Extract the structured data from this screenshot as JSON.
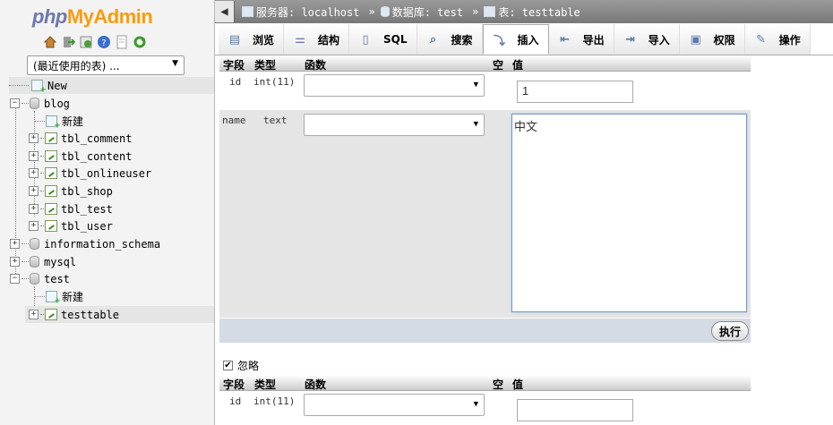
{
  "logo": {
    "part1": "php",
    "part2": "MyAdmin"
  },
  "nav": {
    "icons": [
      "home-icon",
      "logout-icon",
      "query-window-icon",
      "help-icon",
      "docs-icon",
      "reload-icon"
    ],
    "recent_select": "(最近使用的表) ...",
    "tree": [
      {
        "label": "New",
        "type": "new"
      },
      {
        "label": "blog",
        "type": "db"
      },
      {
        "label": "新建",
        "type": "new"
      },
      {
        "label": "tbl_comment",
        "type": "table"
      },
      {
        "label": "tbl_content",
        "type": "table"
      },
      {
        "label": "tbl_onlineuser",
        "type": "table"
      },
      {
        "label": "tbl_shop",
        "type": "table"
      },
      {
        "label": "tbl_test",
        "type": "table"
      },
      {
        "label": "tbl_user",
        "type": "table"
      },
      {
        "label": "information_schema",
        "type": "db"
      },
      {
        "label": "mysql",
        "type": "db"
      },
      {
        "label": "test",
        "type": "db"
      },
      {
        "label": "新建",
        "type": "new"
      },
      {
        "label": "testtable",
        "type": "table"
      }
    ]
  },
  "breadcrumb": {
    "server": "服务器: localhost",
    "database": "数据库: test",
    "table": "表: testtable"
  },
  "tabs": [
    {
      "label": "浏览",
      "icon": "browse-icon"
    },
    {
      "label": "结构",
      "icon": "structure-icon"
    },
    {
      "label": "SQL",
      "icon": "sql-icon"
    },
    {
      "label": "搜索",
      "icon": "search-icon"
    },
    {
      "label": "插入",
      "icon": "insert-icon"
    },
    {
      "label": "导出",
      "icon": "export-icon"
    },
    {
      "label": "导入",
      "icon": "import-icon"
    },
    {
      "label": "权限",
      "icon": "privileges-icon"
    },
    {
      "label": "操作",
      "icon": "operations-icon"
    }
  ],
  "form": {
    "headers": {
      "field": "字段",
      "type": "类型",
      "function": "函数",
      "null": "空",
      "value": "值"
    },
    "rows": [
      {
        "field": "id",
        "type": "int(11)",
        "value": "1"
      },
      {
        "field": "name",
        "type": "text",
        "value": "中文"
      }
    ],
    "submit": "执行",
    "ignore": "忽略",
    "rows2": [
      {
        "field": "id",
        "type": "int(11)",
        "value": ""
      }
    ]
  }
}
